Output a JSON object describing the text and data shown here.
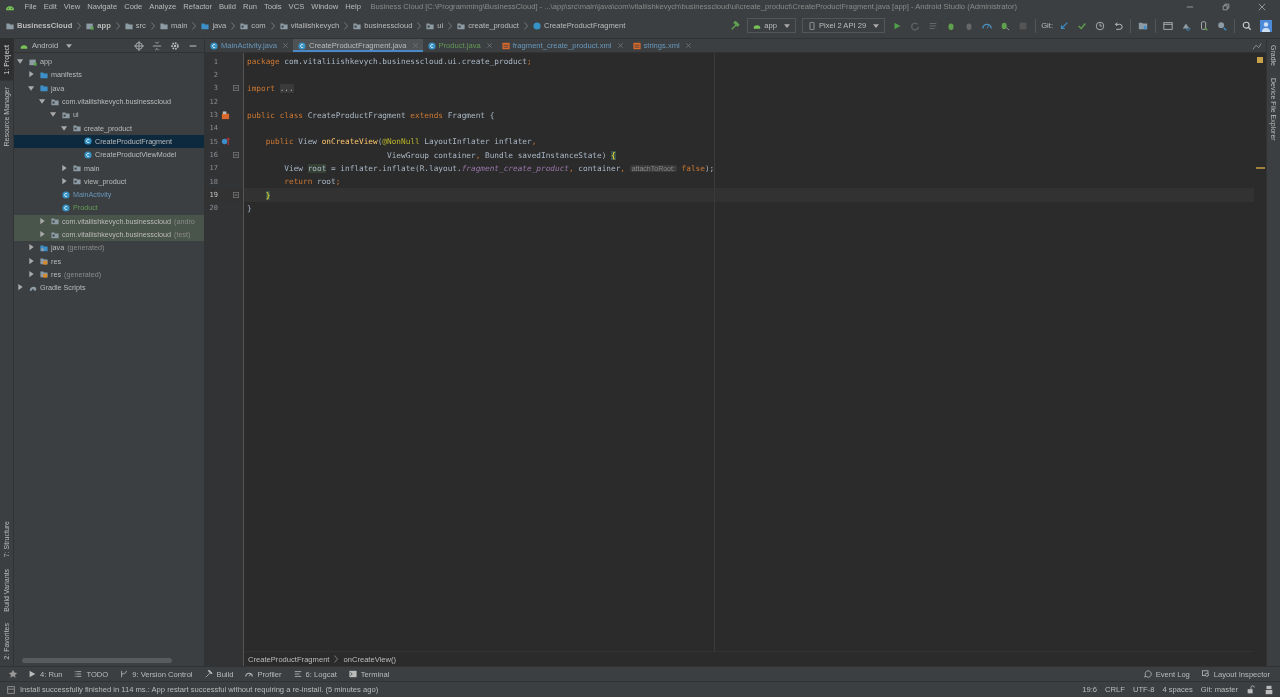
{
  "window": {
    "title": "Business Cloud [C:\\Programming\\BusinessCloud] - ...\\app\\src\\main\\java\\com\\vitaliishkevych\\businesscloud\\ui\\create_product\\CreateProductFragment.java [app] - Android Studio (Administrator)"
  },
  "menu": [
    "File",
    "Edit",
    "View",
    "Navigate",
    "Code",
    "Analyze",
    "Refactor",
    "Build",
    "Run",
    "Tools",
    "VCS",
    "Window",
    "Help"
  ],
  "breadcrumbs": [
    {
      "label": "BusinessCloud",
      "kind": "project"
    },
    {
      "label": "app",
      "kind": "module"
    },
    {
      "label": "src",
      "kind": "folder"
    },
    {
      "label": "main",
      "kind": "folder"
    },
    {
      "label": "java",
      "kind": "source"
    },
    {
      "label": "com",
      "kind": "package"
    },
    {
      "label": "vitaliishkevych",
      "kind": "package"
    },
    {
      "label": "businesscloud",
      "kind": "package"
    },
    {
      "label": "ui",
      "kind": "package"
    },
    {
      "label": "create_product",
      "kind": "package"
    },
    {
      "label": "CreateProductFragment",
      "kind": "class"
    }
  ],
  "toolbar": {
    "run_config": "app",
    "device": "Pixel 2 API 29",
    "git_label": "Git:"
  },
  "left_tool_tabs": {
    "top": [
      {
        "label": "1: Project",
        "selected": true
      },
      {
        "label": "Resource Manager",
        "selected": false
      }
    ],
    "bottom": [
      {
        "label": "7: Structure",
        "selected": false
      },
      {
        "label": "Build Variants",
        "selected": false
      },
      {
        "label": "2: Favorites",
        "selected": false
      }
    ]
  },
  "right_tool_tabs": [
    {
      "label": "Gradle"
    },
    {
      "label": "Device File Explorer"
    }
  ],
  "project_panel": {
    "view": "Android",
    "tree": [
      {
        "label": "app",
        "kind": "module",
        "expanded": true,
        "selected": false,
        "test_scope": false,
        "modified": false,
        "added": false,
        "children": [
          {
            "label": "manifests",
            "kind": "folder",
            "expanded": false,
            "selected": false,
            "test_scope": false,
            "modified": false,
            "added": false
          },
          {
            "label": "java",
            "kind": "folder",
            "expanded": true,
            "selected": false,
            "test_scope": false,
            "modified": false,
            "added": false,
            "children": [
              {
                "label": "com.vitaliishkevych.businesscloud",
                "kind": "package",
                "expanded": true,
                "selected": false,
                "test_scope": false,
                "modified": false,
                "added": false,
                "children": [
                  {
                    "label": "ui",
                    "kind": "package",
                    "expanded": true,
                    "selected": false,
                    "test_scope": false,
                    "modified": false,
                    "added": false,
                    "children": [
                      {
                        "label": "create_product",
                        "kind": "package",
                        "expanded": true,
                        "selected": false,
                        "test_scope": false,
                        "modified": false,
                        "added": false,
                        "children": [
                          {
                            "label": "CreateProductFragment",
                            "kind": "class",
                            "selected": true,
                            "test_scope": false,
                            "modified": false,
                            "added": false
                          },
                          {
                            "label": "CreateProductViewModel",
                            "kind": "class",
                            "selected": false,
                            "test_scope": false,
                            "modified": false,
                            "added": false
                          }
                        ]
                      },
                      {
                        "label": "main",
                        "kind": "package",
                        "expanded": false,
                        "selected": false,
                        "test_scope": false,
                        "modified": false,
                        "added": false
                      },
                      {
                        "label": "view_product",
                        "kind": "package",
                        "expanded": false,
                        "selected": false,
                        "test_scope": false,
                        "modified": false,
                        "added": false
                      }
                    ]
                  },
                  {
                    "label": "MainActivity",
                    "kind": "class",
                    "selected": false,
                    "test_scope": false,
                    "modified": true,
                    "added": false
                  },
                  {
                    "label": "Product",
                    "kind": "class",
                    "selected": false,
                    "test_scope": false,
                    "modified": false,
                    "added": true
                  }
                ]
              },
              {
                "label": "com.vitaliishkevych.businesscloud",
                "note": "(andro",
                "kind": "package",
                "expanded": false,
                "selected": false,
                "test_scope": true,
                "modified": false,
                "added": false
              },
              {
                "label": "com.vitaliishkevych.businesscloud",
                "note": "(test)",
                "kind": "package",
                "expanded": false,
                "selected": false,
                "test_scope": true,
                "modified": false,
                "added": false
              }
            ]
          },
          {
            "label": "java",
            "note": "(generated)",
            "kind": "generated",
            "expanded": false,
            "selected": false,
            "test_scope": false,
            "modified": false,
            "added": false
          },
          {
            "label": "res",
            "kind": "res",
            "expanded": false,
            "selected": false,
            "test_scope": false,
            "modified": false,
            "added": false
          },
          {
            "label": "res",
            "note": "(generated)",
            "kind": "res",
            "expanded": false,
            "selected": false,
            "test_scope": false,
            "modified": false,
            "added": false
          }
        ]
      },
      {
        "label": "Gradle Scripts",
        "kind": "gradle",
        "expanded": false,
        "selected": false,
        "test_scope": false,
        "modified": false,
        "added": false
      }
    ]
  },
  "editor_tabs": [
    {
      "label": "MainActivity.java",
      "kind": "class",
      "selected": false,
      "modified": true,
      "added": false
    },
    {
      "label": "CreateProductFragment.java",
      "kind": "class",
      "selected": true,
      "modified": false,
      "added": false
    },
    {
      "label": "Product.java",
      "kind": "class",
      "selected": false,
      "modified": false,
      "added": true
    },
    {
      "label": "fragment_create_product.xml",
      "kind": "xml",
      "selected": false,
      "modified": true,
      "added": false
    },
    {
      "label": "strings.xml",
      "kind": "xml",
      "selected": false,
      "modified": true,
      "added": false
    }
  ],
  "code": [
    {
      "number": "1",
      "kind": "plain",
      "current": false,
      "tokens": [
        {
          "text": "package ",
          "kind": "keyword"
        },
        {
          "text": "com.vitaliiishkevych.businesscloud.ui.create_product",
          "kind": "plain"
        },
        {
          "text": ";",
          "kind": "keyword"
        }
      ]
    },
    {
      "number": "2",
      "kind": "plain",
      "current": false
    },
    {
      "number": "3",
      "kind": "fold",
      "current": false,
      "tokens": [
        {
          "text": "import ",
          "kind": "keyword"
        },
        {
          "text": "...",
          "kind": "folded"
        }
      ]
    },
    {
      "number": "12",
      "kind": "plain",
      "current": false
    },
    {
      "number": "13",
      "kind": "layout",
      "current": false,
      "tokens": [
        {
          "text": "public class ",
          "kind": "keyword"
        },
        {
          "text": "CreateProductFragment ",
          "kind": "plain"
        },
        {
          "text": "extends ",
          "kind": "keyword"
        },
        {
          "text": "Fragment {",
          "kind": "plain"
        }
      ]
    },
    {
      "number": "14",
      "kind": "plain",
      "current": false
    },
    {
      "number": "15",
      "kind": "override",
      "current": false,
      "tokens": [
        {
          "text": "    public ",
          "kind": "keyword"
        },
        {
          "text": "View ",
          "kind": "plain"
        },
        {
          "text": "onCreateView",
          "kind": "method"
        },
        {
          "text": "(",
          "kind": "plain"
        },
        {
          "text": "@NonNull ",
          "kind": "annotation"
        },
        {
          "text": "LayoutInflater inflater",
          "kind": "plain"
        },
        {
          "text": ",",
          "kind": "keyword"
        }
      ]
    },
    {
      "number": "16",
      "kind": "fold",
      "current": false,
      "tokens": [
        {
          "text": "                              ViewGroup container",
          "kind": "plain"
        },
        {
          "text": ", ",
          "kind": "keyword"
        },
        {
          "text": "Bundle savedInstanceState) ",
          "kind": "plain"
        },
        {
          "text": "{",
          "kind": "brace"
        }
      ]
    },
    {
      "number": "17",
      "kind": "plain",
      "current": false,
      "tokens": [
        {
          "text": "        View ",
          "kind": "plain"
        },
        {
          "text": "root",
          "kind": "usage"
        },
        {
          "text": " = inflater.inflate(R.layout.",
          "kind": "plain"
        },
        {
          "text": "fragment_create_product",
          "kind": "field"
        },
        {
          "text": ", ",
          "kind": "keyword"
        },
        {
          "text": "container",
          "kind": "plain"
        },
        {
          "text": ", ",
          "kind": "keyword"
        },
        {
          "text": "attachToRoot:",
          "kind": "hint"
        },
        {
          "text": " false",
          "kind": "keyword"
        },
        {
          "text": ");",
          "kind": "plain"
        }
      ]
    },
    {
      "number": "18",
      "kind": "plain",
      "current": false,
      "tokens": [
        {
          "text": "        return ",
          "kind": "keyword"
        },
        {
          "text": "root",
          "kind": "plain"
        },
        {
          "text": ";",
          "kind": "keyword"
        }
      ]
    },
    {
      "number": "19",
      "kind": "fold",
      "current": true,
      "tokens": [
        {
          "text": "    }",
          "kind": "brace"
        }
      ]
    },
    {
      "number": "20",
      "kind": "plain",
      "current": false,
      "tokens": [
        {
          "text": "}",
          "kind": "plain"
        }
      ]
    }
  ],
  "editor_breadcrumbs": [
    "CreateProductFragment",
    "onCreateView()"
  ],
  "bottom_tools": {
    "left": [
      {
        "label": "4: Run",
        "kind": "run"
      },
      {
        "label": "TODO",
        "kind": "todo"
      },
      {
        "label": "9: Version Control",
        "kind": "vcs"
      },
      {
        "label": "Build",
        "kind": "build"
      },
      {
        "label": "Profiler",
        "kind": "profiler"
      },
      {
        "label": "6: Logcat",
        "kind": "logcat"
      },
      {
        "label": "Terminal",
        "kind": "terminal"
      }
    ],
    "right": [
      {
        "label": "Event Log",
        "kind": "event"
      },
      {
        "label": "Layout Inspector",
        "kind": "inspector"
      }
    ]
  },
  "status_bar": {
    "message": "Install successfully finished in 114 ms.: App restart successful without requiring a re-install. (5 minutes ago)",
    "items": [
      "19:6",
      "CRLF",
      "UTF-8",
      "4 spaces",
      "Git: master"
    ]
  }
}
